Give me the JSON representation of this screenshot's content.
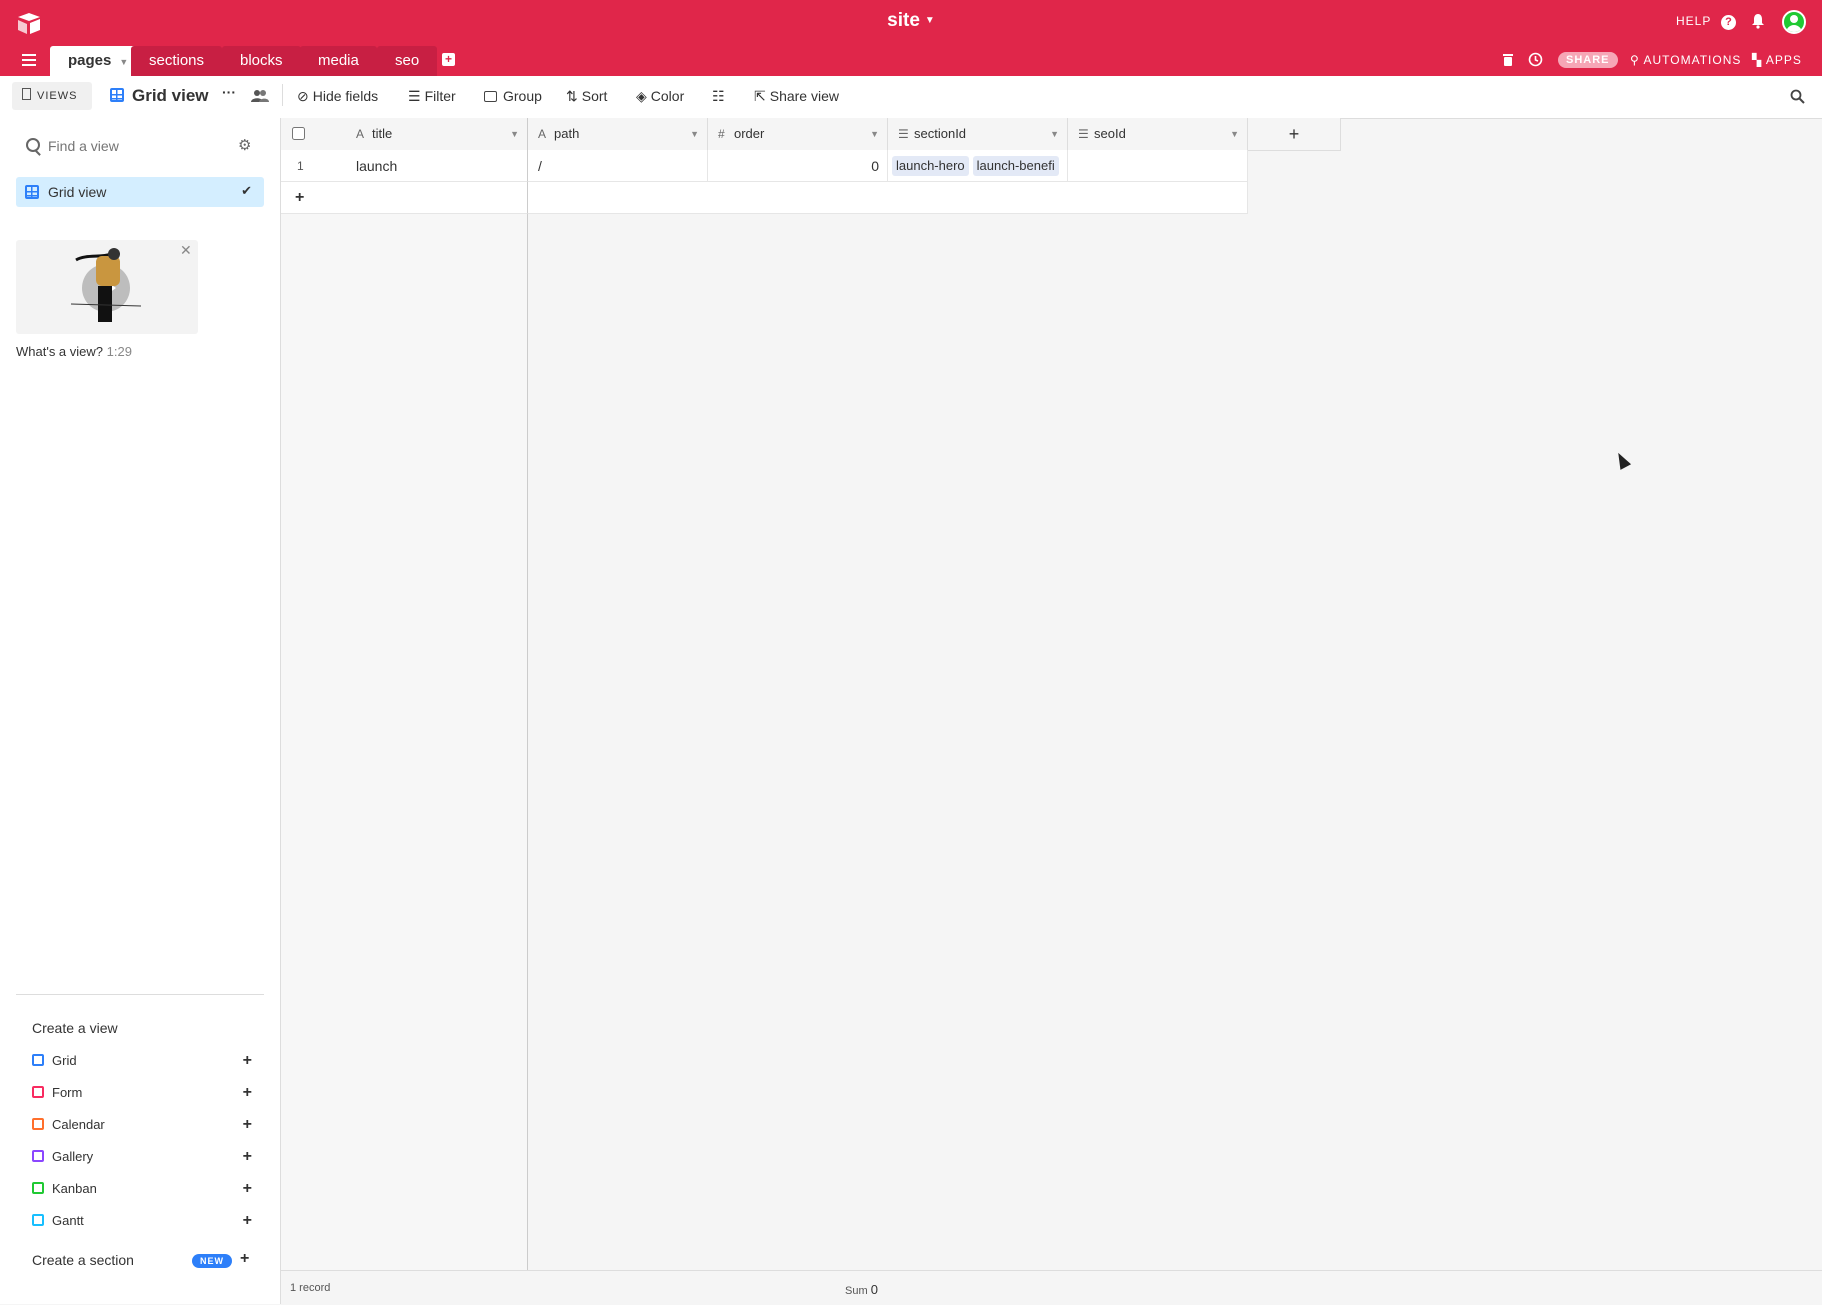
{
  "topbar": {
    "base_title": "site",
    "help_label": "HELP",
    "help_icon": "?",
    "tables": [
      {
        "label": "pages"
      },
      {
        "label": "sections"
      },
      {
        "label": "blocks"
      },
      {
        "label": "media"
      },
      {
        "label": "seo"
      }
    ],
    "share_label": "SHARE",
    "automations_label": "AUTOMATIONS",
    "apps_label": "APPS",
    "accent_color": "#e0264a"
  },
  "toolbar": {
    "views_label": "VIEWS",
    "view_name": "Grid view",
    "hide_fields": "Hide fields",
    "filter": "Filter",
    "group": "Group",
    "sort": "Sort",
    "color": "Color",
    "share_view": "Share view"
  },
  "sidebar": {
    "find_placeholder": "Find a view",
    "views": [
      {
        "label": "Grid view"
      }
    ],
    "video_caption": "What's a view?",
    "video_duration": "1:29",
    "create_view_title": "Create a view",
    "create_items": [
      {
        "label": "Grid",
        "color": "#2d7ff9"
      },
      {
        "label": "Form",
        "color": "#f82b60"
      },
      {
        "label": "Calendar",
        "color": "#ff6f2c"
      },
      {
        "label": "Gallery",
        "color": "#8b46ff"
      },
      {
        "label": "Kanban",
        "color": "#20c933"
      },
      {
        "label": "Gantt",
        "color": "#18bfff"
      }
    ],
    "create_section": "Create a section",
    "new_badge": "NEW"
  },
  "grid": {
    "columns": [
      {
        "label": "title",
        "type_icon": "A"
      },
      {
        "label": "path",
        "type_icon": "A"
      },
      {
        "label": "order",
        "type_icon": "#"
      },
      {
        "label": "sectionId",
        "type_icon": "link"
      },
      {
        "label": "seoId",
        "type_icon": "link"
      }
    ],
    "rows": [
      {
        "num": "1",
        "title": "launch",
        "path": "/",
        "order": "0",
        "sectionId": [
          "launch-hero",
          "launch-benefi"
        ],
        "seoId": ""
      }
    ]
  },
  "footer": {
    "record_count": "1 record",
    "sum_label": "Sum",
    "sum_value": "0"
  }
}
